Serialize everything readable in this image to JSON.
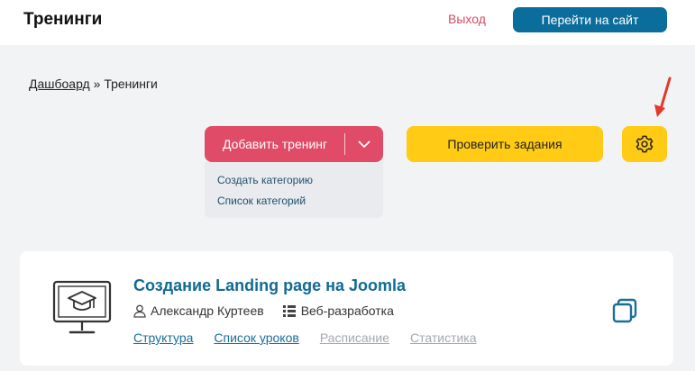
{
  "header": {
    "title": "Тренинги",
    "logout_label": "Выход",
    "go_site_label": "Перейти на сайт"
  },
  "breadcrumb": {
    "home": "Дашбоард",
    "separator": " » ",
    "current": "Тренинги"
  },
  "toolbar": {
    "add_training_label": "Добавить тренинг",
    "dropdown_items": [
      "Создать категорию",
      "Список категорий"
    ],
    "check_tasks_label": "Проверить задания",
    "settings_icon": "gear-icon"
  },
  "training": {
    "title": "Создание Landing page на Joomla",
    "author": "Александр Куртеев",
    "category": "Веб-разработка",
    "links": [
      "Структура",
      "Список уроков",
      "Расписание",
      "Статистика"
    ]
  },
  "colors": {
    "primary": "#0b6d9b",
    "danger": "#e04b67",
    "accent": "#ffcb14",
    "link": "#116b94"
  }
}
